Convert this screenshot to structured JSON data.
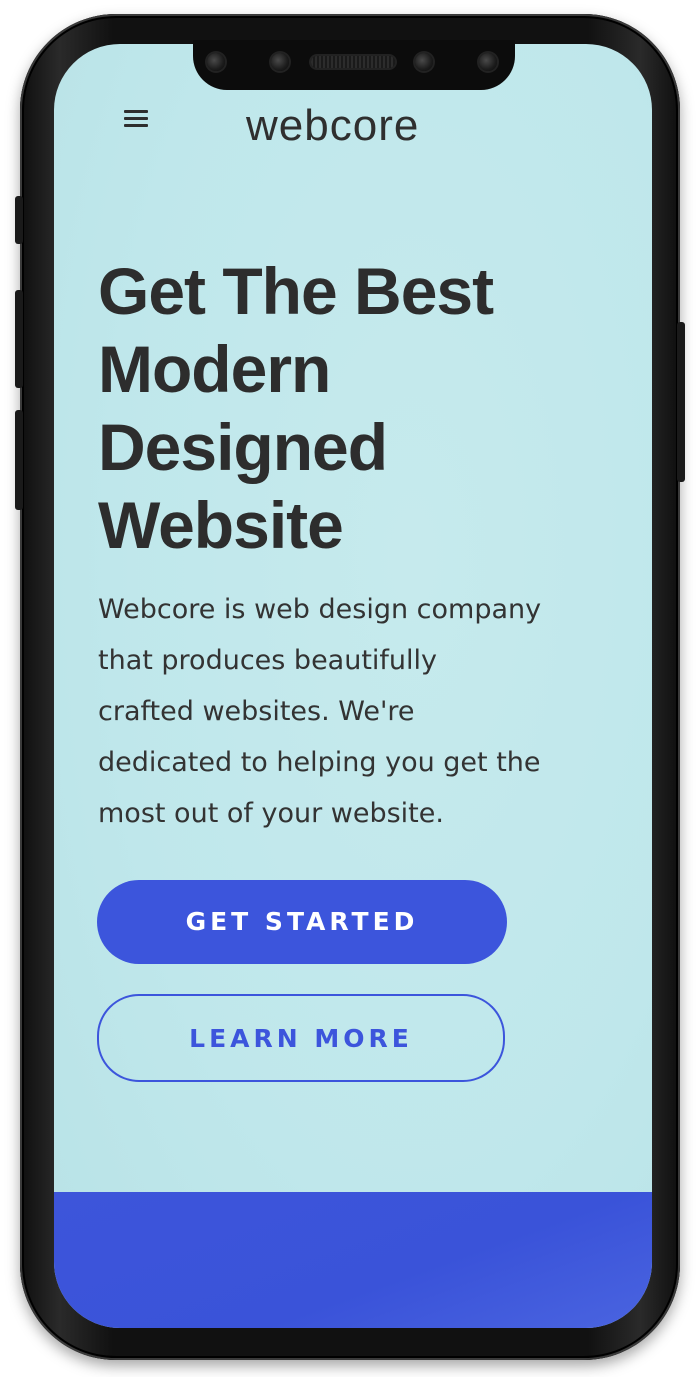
{
  "header": {
    "brand": "webcore",
    "menu_icon": "hamburger-menu-icon"
  },
  "hero": {
    "headline_lines": [
      "Get The Best",
      "Modern",
      "Designed",
      "Website"
    ],
    "description_lines": [
      "Webcore is web design company",
      "that produces beautifully",
      "crafted websites. We're",
      "dedicated to helping you get the",
      "most out of your website."
    ]
  },
  "buttons": {
    "primary_label": "GET STARTED",
    "secondary_label": "LEARN MORE"
  },
  "colors": {
    "background": "#c0e7eb",
    "accent": "#3c55dc",
    "text": "#2d2d2d"
  }
}
